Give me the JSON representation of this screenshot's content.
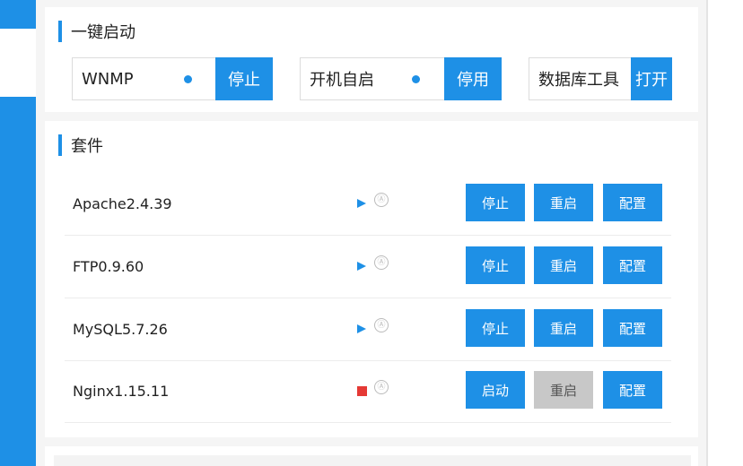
{
  "quick_start": {
    "title": "一键启动",
    "items": [
      {
        "label": "WNMP",
        "has_dot": true,
        "button": "停止"
      },
      {
        "label": "开机自启",
        "has_dot": true,
        "button": "停用"
      },
      {
        "label": "数据库工具",
        "has_dot": false,
        "button": "打开"
      }
    ]
  },
  "suite": {
    "title": "套件",
    "rows": [
      {
        "name": "Apache2.4.39",
        "state_icon": "play-icon",
        "auto_icon": "Ⓐ",
        "btn1": "停止",
        "btn2": "重启",
        "btn3": "配置",
        "btn2_disabled": false
      },
      {
        "name": "FTP0.9.60",
        "state_icon": "play-icon",
        "auto_icon": "Ⓐ",
        "btn1": "停止",
        "btn2": "重启",
        "btn3": "配置",
        "btn2_disabled": false
      },
      {
        "name": "MySQL5.7.26",
        "state_icon": "play-icon",
        "auto_icon": "Ⓐ",
        "btn1": "停止",
        "btn2": "重启",
        "btn3": "配置",
        "btn2_disabled": false
      },
      {
        "name": "Nginx1.15.11",
        "state_icon": "stop-icon",
        "auto_icon": "Ⓐ",
        "btn1": "启动",
        "btn2": "重启",
        "btn3": "配置",
        "btn2_disabled": true
      }
    ]
  },
  "colors": {
    "accent": "#1e90e6",
    "stopped": "#e53935",
    "disabled": "#c8c8c8"
  }
}
